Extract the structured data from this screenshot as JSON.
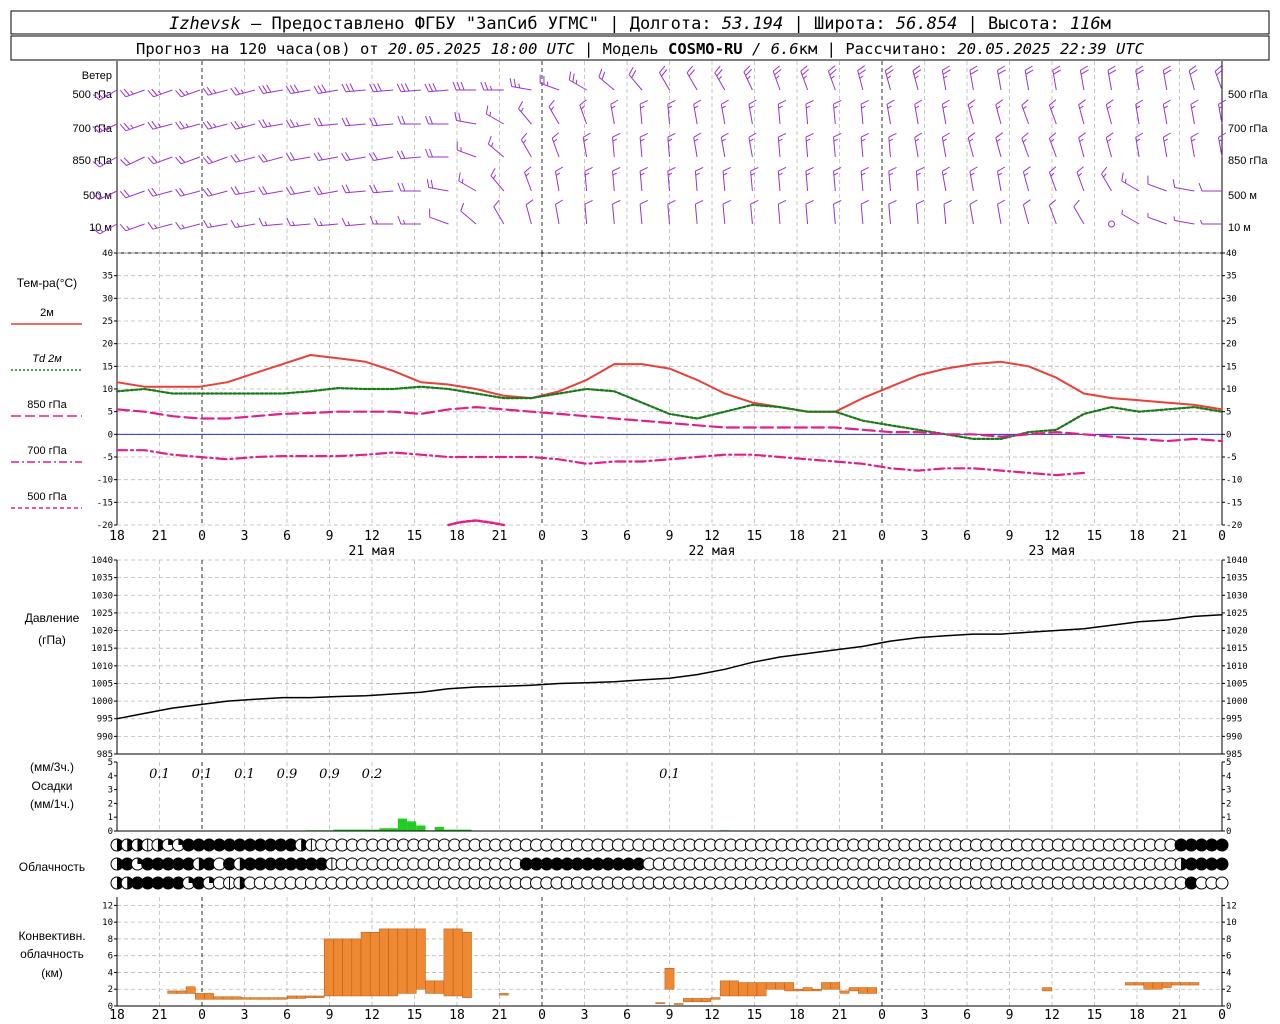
{
  "header": {
    "city": "Izhevsk",
    "provider": "– Предоставлено ФГБУ \"ЗапСиб УГМС\"",
    "lon_label": "Долгота:",
    "lon_value": "53.194",
    "lat_label": "Широта:",
    "lat_value": "56.854",
    "alt_label": "Высота:",
    "alt_value": "116",
    "alt_unit": "м",
    "forecast_label": "Прогноз на 120 часа(ов) от",
    "forecast_time": "20.05.2025 18:00 UTC",
    "model_label": "Модель",
    "model_name": "COSMO-RU",
    "model_res": "/ 6.6",
    "model_res_unit": "км",
    "calc_label": "Рассчитано:",
    "calc_time": "20.05.2025 22:39 UTC"
  },
  "wind_panel": {
    "title": "Ветер",
    "levels": [
      "500 гПа",
      "700 гПа",
      "850 гПа",
      "500  м",
      "10  м"
    ],
    "barb_color": "#9933cc"
  },
  "time_axis": {
    "hour_labels": [
      "18",
      "21",
      "0",
      "3",
      "6",
      "9",
      "12",
      "15",
      "18",
      "21",
      "0",
      "3",
      "6",
      "9",
      "12",
      "15",
      "18",
      "21",
      "0",
      "3",
      "6",
      "9",
      "12",
      "15",
      "18",
      "21",
      "0"
    ],
    "day_labels": [
      "21 мая",
      "22 мая",
      "23 мая"
    ]
  },
  "temp_panel": {
    "title": "Тем-ра(°C)",
    "legend": [
      {
        "label": "2м",
        "color": "#e8403a",
        "dash": "solid"
      },
      {
        "label": "Td  2м",
        "color": "#1a7a1a",
        "dash": "dotted"
      },
      {
        "label": "850 гПа",
        "color": "#e0208a",
        "dash": "longdash"
      },
      {
        "label": "700 гПа",
        "color": "#e0208a",
        "dash": "dashdot"
      },
      {
        "label": "500 гПа",
        "color": "#e0208a",
        "dash": "shortdash"
      }
    ]
  },
  "pressure_panel": {
    "title": "Давление",
    "unit": "(гПа)"
  },
  "precip_panel": {
    "unit_3h": "(мм/3ч.)",
    "title": "Осадки",
    "unit_1h": "(мм/1ч.)",
    "totals": [
      {
        "x": 3,
        "label": "0.1"
      },
      {
        "x": 6,
        "label": "0.1"
      },
      {
        "x": 9,
        "label": "0.1"
      },
      {
        "x": 12,
        "label": "0.9"
      },
      {
        "x": 15,
        "label": "0.9"
      },
      {
        "x": 18,
        "label": "0.2"
      },
      {
        "x": 39,
        "label": "0.1"
      }
    ],
    "bar_color": "#22cc22"
  },
  "cloud_panel": {
    "title": "Облачность",
    "rows": [
      "3331322444444444443100000000000000000000000000000000000000000000000000000000000000000000000000000000000044444",
      "3424444434043444444441000000000000000000444444444444000000000000000000000000000000000000000000000000000034444",
      "3344444242013000000000000000000000000000000000000000000000000000000000000000000000000000000000000000000004000"
    ]
  },
  "conv_panel": {
    "title_1": "Конвективн.",
    "title_2": "облачность",
    "unit": "(км)",
    "fill_color": "#ee8833"
  },
  "chart_data": {
    "type": "line",
    "x_unit": "hours from 20.05.2025 18:00 UTC",
    "wind": {
      "levels": [
        "500 гПа",
        "700 гПа",
        "850 гПа",
        "500  м",
        "10  м"
      ],
      "x": [
        0,
        3,
        6,
        9,
        12,
        15,
        18,
        21,
        24,
        27,
        30,
        33,
        36,
        39,
        42,
        45,
        48,
        51,
        54,
        57,
        60,
        63,
        66,
        69,
        72,
        75,
        78,
        81,
        84,
        87,
        90,
        93,
        96,
        99,
        102,
        105,
        108,
        111,
        114,
        117,
        120
      ],
      "direction_deg": [
        [
          240,
          250,
          250,
          250,
          255,
          255,
          260,
          260,
          260,
          265,
          265,
          265,
          265,
          270,
          270,
          280,
          290,
          300,
          310,
          320,
          330,
          330,
          330,
          335,
          340,
          340,
          340,
          345,
          345,
          345,
          350,
          350,
          350,
          350,
          350,
          350,
          350,
          350,
          350,
          345,
          340
        ],
        [
          245,
          250,
          255,
          255,
          255,
          255,
          260,
          260,
          265,
          265,
          265,
          270,
          270,
          280,
          300,
          320,
          330,
          340,
          350,
          355,
          355,
          350,
          350,
          350,
          355,
          355,
          355,
          355,
          350,
          350,
          350,
          345,
          345,
          340,
          340,
          345,
          345,
          350,
          350,
          350,
          350
        ],
        [
          240,
          245,
          250,
          250,
          250,
          255,
          255,
          260,
          260,
          260,
          260,
          265,
          270,
          290,
          310,
          330,
          340,
          350,
          355,
          355,
          355,
          350,
          350,
          350,
          355,
          355,
          355,
          355,
          355,
          350,
          350,
          345,
          345,
          340,
          340,
          345,
          345,
          350,
          350,
          350,
          350
        ],
        [
          245,
          250,
          255,
          255,
          255,
          260,
          260,
          260,
          260,
          265,
          265,
          270,
          280,
          300,
          320,
          340,
          350,
          355,
          355,
          355,
          355,
          355,
          355,
          355,
          355,
          355,
          355,
          355,
          355,
          355,
          350,
          350,
          350,
          345,
          340,
          340,
          330,
          300,
          290,
          280,
          270
        ],
        [
          240,
          250,
          255,
          255,
          260,
          260,
          265,
          265,
          265,
          265,
          270,
          270,
          290,
          310,
          330,
          345,
          350,
          355,
          355,
          355,
          355,
          355,
          355,
          355,
          355,
          355,
          355,
          355,
          355,
          355,
          355,
          350,
          350,
          345,
          340,
          330,
          0,
          300,
          290,
          280,
          270
        ]
      ],
      "speed_ms": [
        [
          12,
          12,
          12,
          13,
          13,
          13,
          14,
          14,
          14,
          14,
          14,
          14,
          14,
          14,
          13,
          12,
          12,
          12,
          11,
          11,
          11,
          11,
          12,
          12,
          12,
          12,
          12,
          12,
          12,
          12,
          12,
          11,
          11,
          11,
          11,
          11,
          11,
          11,
          10,
          10,
          10
        ],
        [
          12,
          12,
          12,
          12,
          12,
          12,
          12,
          12,
          11,
          11,
          11,
          11,
          10,
          9,
          8,
          8,
          8,
          8,
          8,
          8,
          8,
          8,
          8,
          8,
          8,
          8,
          8,
          8,
          8,
          8,
          8,
          8,
          8,
          8,
          8,
          8,
          8,
          8,
          7,
          7,
          7
        ],
        [
          11,
          11,
          11,
          11,
          11,
          11,
          10,
          10,
          10,
          10,
          10,
          10,
          9,
          8,
          8,
          8,
          8,
          8,
          8,
          8,
          8,
          8,
          7,
          7,
          8,
          8,
          8,
          8,
          8,
          8,
          8,
          8,
          7,
          7,
          7,
          7,
          7,
          7,
          7,
          7,
          7
        ],
        [
          10,
          10,
          10,
          10,
          10,
          10,
          10,
          10,
          10,
          10,
          10,
          10,
          9,
          8,
          8,
          7,
          7,
          7,
          7,
          7,
          7,
          7,
          7,
          7,
          7,
          7,
          7,
          7,
          7,
          7,
          7,
          7,
          7,
          7,
          7,
          7,
          7,
          7,
          6,
          6,
          6
        ],
        [
          7,
          7,
          7,
          7,
          7,
          7,
          7,
          7,
          7,
          7,
          7,
          7,
          6,
          6,
          5,
          5,
          5,
          5,
          5,
          5,
          5,
          5,
          5,
          5,
          5,
          5,
          5,
          5,
          5,
          5,
          5,
          5,
          5,
          5,
          5,
          5,
          0,
          3,
          3,
          3,
          3
        ]
      ]
    },
    "temperature": {
      "ylim": [
        -20,
        40
      ],
      "yticks": [
        40,
        35,
        30,
        25,
        20,
        15,
        10,
        5,
        0,
        -5,
        -10,
        -15,
        -20
      ],
      "x": [
        0,
        3,
        6,
        9,
        12,
        15,
        18,
        21,
        24,
        27,
        30,
        33,
        36,
        39,
        42,
        45,
        48,
        51,
        54,
        57,
        60,
        63,
        66,
        69,
        72,
        75,
        78,
        81,
        84,
        87,
        90,
        93,
        96,
        99,
        102,
        105,
        108,
        111,
        114,
        117,
        120
      ],
      "series": [
        {
          "name": "2м",
          "values": [
            11.5,
            10.5,
            10.5,
            10.5,
            11.5,
            13.5,
            15.5,
            17.5,
            16.8,
            16,
            14,
            11.5,
            11,
            10,
            8.5,
            8,
            9.5,
            12,
            15.5,
            15.5,
            14.5,
            12,
            9,
            7,
            6,
            5,
            5,
            8,
            10.5,
            13,
            14.5,
            15.5,
            16,
            15,
            12.5,
            9,
            8,
            7.5,
            7,
            6.5,
            5.5
          ]
        },
        {
          "name": "Td  2м",
          "values": [
            9.5,
            10,
            9,
            9,
            9,
            9,
            9,
            9.5,
            10.2,
            10,
            10,
            10.5,
            10,
            9,
            8,
            8,
            9,
            10,
            9.5,
            7,
            4.5,
            3.5,
            5,
            6.5,
            6,
            5,
            5,
            3,
            2,
            1,
            0,
            -1,
            -1,
            0.5,
            1,
            4.5,
            6,
            5,
            5.5,
            6,
            5
          ]
        },
        {
          "name": "850 гПа",
          "values": [
            5.5,
            5,
            4,
            3.5,
            3.5,
            4,
            4.5,
            4.7,
            5,
            5,
            5,
            4.5,
            5.5,
            6,
            5.5,
            5,
            4.5,
            4,
            3.5,
            3,
            2.5,
            2,
            1.5,
            1.5,
            1.5,
            1.5,
            1.5,
            1,
            0.5,
            0.5,
            0,
            0,
            -0.5,
            0,
            0.5,
            0,
            -0.5,
            -1,
            -1.5,
            -1,
            -1.5
          ]
        },
        {
          "name": "700 гПа",
          "values": [
            -3.5,
            -3.5,
            -4.5,
            -5,
            -5.5,
            -5,
            -4.8,
            -4.8,
            -4.8,
            -4.5,
            -4,
            -4.5,
            -5,
            -5,
            -5,
            -5,
            -5.5,
            -6.5,
            -6,
            -6,
            -5.5,
            -5,
            -4.5,
            -4.5,
            -5,
            -5.5,
            -6,
            -6.5,
            -7.5,
            -8,
            -7.5,
            -7.5,
            -8,
            -8.5,
            -9,
            -8.5
          ]
        },
        {
          "name": "500 гПа",
          "x": [
            36,
            37,
            38,
            39,
            40,
            41,
            42
          ],
          "values": [
            -20,
            -19.5,
            -19.2,
            -19,
            -19.3,
            -19.6,
            -20
          ]
        }
      ]
    },
    "pressure": {
      "ylim": [
        985,
        1040
      ],
      "yticks": [
        1040,
        1035,
        1030,
        1025,
        1020,
        1015,
        1010,
        1005,
        1000,
        995,
        990,
        985
      ],
      "x": [
        0,
        3,
        6,
        9,
        12,
        15,
        18,
        21,
        24,
        27,
        30,
        33,
        36,
        39,
        42,
        45,
        48,
        51,
        54,
        57,
        60,
        63,
        66,
        69,
        72,
        75,
        78,
        81,
        84,
        87,
        90,
        93,
        96,
        99,
        102,
        105,
        108,
        111,
        114,
        117,
        120
      ],
      "values": [
        995,
        996.5,
        998,
        999,
        1000,
        1000.5,
        1001,
        1001,
        1001.3,
        1001.5,
        1002,
        1002.5,
        1003.5,
        1004,
        1004.2,
        1004.5,
        1005,
        1005.2,
        1005.5,
        1006,
        1006.5,
        1007.5,
        1009,
        1011,
        1012.5,
        1013.5,
        1014.5,
        1015.5,
        1017,
        1018,
        1018.5,
        1019,
        1019,
        1019.5,
        1020,
        1020.5,
        1021.5,
        1022.5,
        1023,
        1024,
        1024.5
      ]
    },
    "precipitation": {
      "ylim": [
        0,
        5
      ],
      "yticks": [
        5,
        4,
        3,
        2,
        1,
        0
      ],
      "x": [
        21,
        22,
        23,
        24,
        25,
        26,
        27,
        28,
        29,
        30,
        31,
        32,
        33,
        34,
        35,
        36,
        37,
        38,
        66
      ],
      "values": [
        0.05,
        0.05,
        0.05,
        0.1,
        0.1,
        0.1,
        0.1,
        0.1,
        0.2,
        0.2,
        0.9,
        0.7,
        0.4,
        0.05,
        0.3,
        0.1,
        0.1,
        0.1,
        0.05
      ]
    },
    "convective_cloud": {
      "ylim": [
        0,
        13
      ],
      "yticks": [
        12,
        10,
        8,
        6,
        4,
        2,
        0
      ],
      "x": [
        6,
        7,
        8,
        9,
        10,
        11,
        12,
        13,
        14,
        15,
        16,
        17,
        18,
        19,
        20,
        21,
        22,
        23,
        24,
        25,
        26,
        27,
        28,
        29,
        30,
        31,
        32,
        33,
        34,
        35,
        36,
        37,
        38,
        42,
        59,
        60,
        61,
        62,
        63,
        64,
        65,
        66,
        67,
        68,
        69,
        70,
        71,
        72,
        73,
        74,
        75,
        76,
        77,
        78,
        79,
        80,
        81,
        82,
        101,
        110,
        111,
        112,
        113,
        114,
        115,
        116,
        117
      ],
      "base": [
        1.5,
        1.5,
        1.5,
        0.8,
        0.8,
        0.8,
        0.8,
        0.8,
        0.8,
        0.8,
        0.8,
        0.8,
        0.8,
        0.9,
        0.9,
        1.0,
        1.0,
        1.2,
        1.2,
        1.2,
        1.2,
        1.2,
        1.2,
        1.2,
        1.2,
        1.5,
        1.5,
        2.0,
        1.5,
        1.5,
        1.2,
        1.2,
        1.0,
        1.3,
        0.3,
        2.0,
        0.2,
        0.5,
        0.5,
        0.5,
        0.8,
        1.2,
        1.2,
        1.2,
        1.2,
        1.2,
        2.0,
        2.0,
        1.8,
        1.8,
        1.8,
        1.8,
        2.0,
        2.0,
        1.5,
        1.8,
        1.5,
        1.5,
        1.8,
        2.5,
        2.5,
        2.0,
        2.0,
        2.2,
        2.5,
        2.5,
        2.5
      ],
      "top": [
        1.8,
        1.8,
        2.3,
        1.5,
        1.5,
        1.1,
        1.1,
        1.1,
        1.0,
        1.0,
        1.0,
        1.0,
        1.0,
        1.2,
        1.2,
        1.2,
        1.2,
        8.0,
        8.0,
        8.0,
        8.0,
        8.8,
        8.8,
        9.2,
        9.2,
        9.2,
        9.2,
        9.2,
        3.0,
        3.0,
        9.2,
        9.2,
        8.8,
        1.5,
        0.4,
        4.5,
        0.3,
        0.9,
        0.9,
        0.9,
        1.0,
        3.0,
        3.0,
        2.8,
        2.8,
        2.8,
        2.8,
        2.8,
        2.8,
        2.0,
        2.2,
        2.0,
        2.8,
        2.8,
        1.8,
        2.2,
        2.2,
        2.2,
        2.2,
        2.8,
        2.8,
        2.8,
        2.8,
        2.8,
        2.8,
        2.8,
        2.8
      ]
    }
  }
}
